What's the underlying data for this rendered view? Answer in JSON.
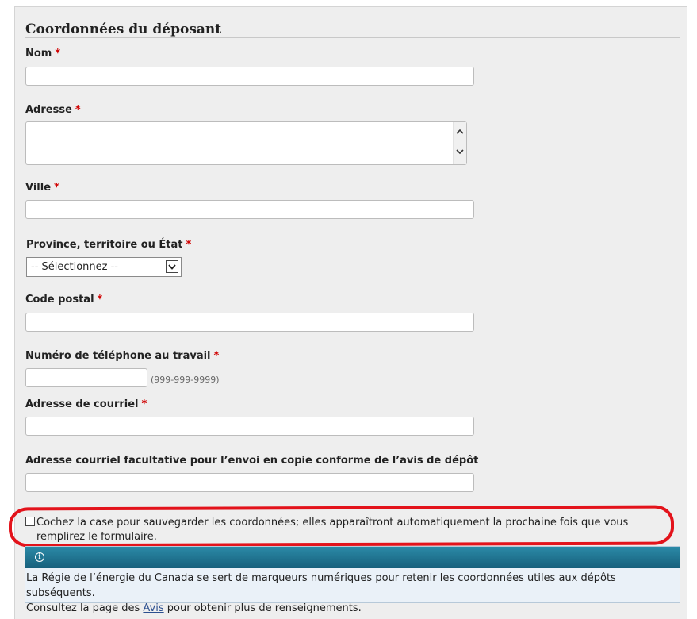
{
  "section": {
    "title": "Coordonnées du déposant"
  },
  "required_marker": "*",
  "fields": {
    "name": {
      "label": "Nom",
      "value": ""
    },
    "address": {
      "label": "Adresse",
      "value": ""
    },
    "city": {
      "label": "Ville",
      "value": ""
    },
    "province": {
      "label": "Province, territoire ou État",
      "selected": "-- Sélectionnez --"
    },
    "postal_code": {
      "label": "Code postal",
      "value": ""
    },
    "work_phone": {
      "label": "Numéro de téléphone au travail",
      "value": "",
      "hint": "(999-999-9999)"
    },
    "email": {
      "label": "Adresse de courriel",
      "value": ""
    },
    "cc_email": {
      "label": "Adresse courriel facultative pour l’envoi en copie conforme de l’avis de dépôt",
      "value": ""
    }
  },
  "save_checkbox": {
    "checked": false,
    "label": "Cochez la case pour sauvegarder les coordonnées; elles apparaîtront automatiquement la prochaine fois que vous remplirez le formulaire."
  },
  "info": {
    "icon": "info-icon",
    "line1": "La Régie de l’énergie du Canada se sert de marqueurs numériques pour retenir les coordonnées utiles aux dépôts subséquents.",
    "line2_prefix": "Consultez la page des ",
    "link_text": "Avis",
    "line2_suffix": " pour obtenir plus de renseignements."
  },
  "colors": {
    "required": "#d00000",
    "callout": "#e3131b",
    "info_header": "#1f6f8b",
    "link": "#2b4f8f"
  }
}
